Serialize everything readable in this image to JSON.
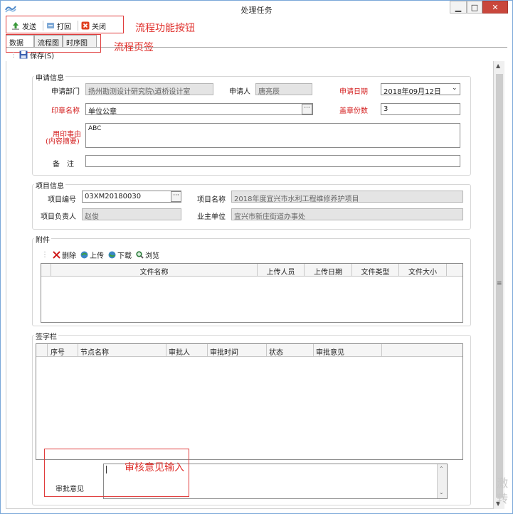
{
  "window": {
    "title": "处理任务",
    "controls": {
      "minimize": "▁",
      "maximize": "□",
      "close": "✕"
    }
  },
  "toolbar": {
    "send": "发送",
    "recall": "打回",
    "close": "关闭"
  },
  "tabs": [
    "数据",
    "流程图",
    "时序图"
  ],
  "save_label": "保存(S)",
  "annotations": {
    "toolbar_note": "流程功能按钮",
    "tabs_note": "流程页签",
    "review_note": "审核意见输入"
  },
  "apply_info": {
    "title": "申请信息",
    "dept_label": "申请部门",
    "dept_value": "扬州勘测设计研究院\\道桥设计室",
    "applicant_label": "申请人",
    "applicant_value": "唐亮辰",
    "date_label": "申请日期",
    "date_value": "2018年09月12日",
    "seal_label": "印章名称",
    "seal_value": "单位公章",
    "copies_label": "盖章份数",
    "copies_value": "3",
    "reason_label_1": "用印事由",
    "reason_label_2": "(内容摘要)",
    "reason_value": "ABC",
    "remark_label": "备　注",
    "remark_value": ""
  },
  "project_info": {
    "title": "项目信息",
    "code_label": "项目编号",
    "code_value": "03XM20180030",
    "name_label": "项目名称",
    "name_value": "2018年度宜兴市水利工程维修养护项目",
    "lead_label": "项目负责人",
    "lead_value": "赵俊",
    "owner_label": "业主单位",
    "owner_value": "宜兴市新庄街道办事处"
  },
  "attachments": {
    "title": "附件",
    "delete": "删除",
    "upload": "上传",
    "download": "下载",
    "browse": "浏览",
    "columns": [
      "文件名称",
      "上传人员",
      "上传日期",
      "文件类型",
      "文件大小"
    ]
  },
  "signatures": {
    "title": "签字栏",
    "columns": [
      "序号",
      "节点名称",
      "审批人",
      "审批时间",
      "状态",
      "审批意见"
    ]
  },
  "review": {
    "label": "审批意见",
    "value": ""
  },
  "side_watermark": [
    "激",
    "转"
  ]
}
